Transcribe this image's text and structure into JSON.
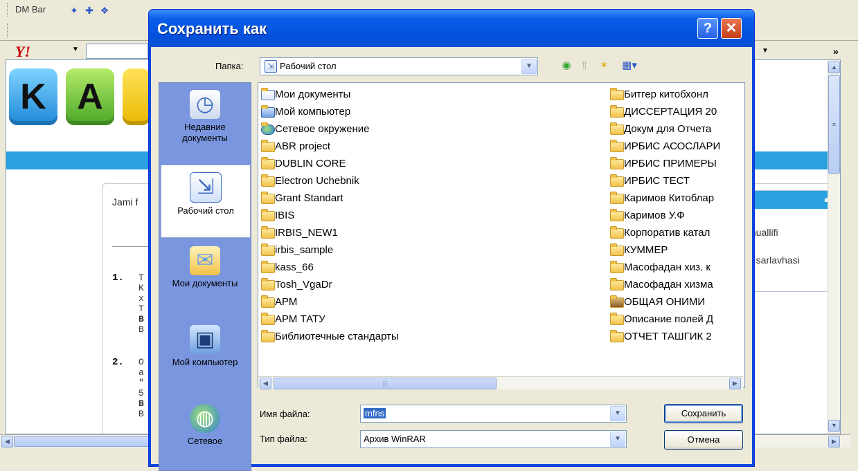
{
  "browser": {
    "toolbar_label": "DM Bar",
    "yahoo_logo": "Y!",
    "overflow": "»",
    "logo_letters": [
      "K",
      "A"
    ],
    "panel_text": "Jami f",
    "list_numbers": [
      "1.",
      "2."
    ],
    "col_fragment_1": [
      "T",
      "K",
      "x",
      "T",
      "B",
      "B"
    ],
    "col_fragment_2": [
      "O",
      "a",
      "\"",
      "5",
      "B",
      "B"
    ],
    "right_panel_lines": [
      "h",
      "muallifi",
      "b sarlavhasi"
    ]
  },
  "dialog": {
    "title": "Сохранить как",
    "help_label": "?",
    "close_label": "✕",
    "folder_label": "Папка:",
    "folder_value": "Рабочий стол",
    "places": [
      {
        "label": "Недавние документы",
        "icon": "recent-documents-icon"
      },
      {
        "label": "Рабочий стол",
        "icon": "desktop-icon"
      },
      {
        "label": "Мои документы",
        "icon": "my-documents-icon"
      },
      {
        "label": "Мой компьютер",
        "icon": "my-computer-icon"
      },
      {
        "label": "Сетевое",
        "icon": "network-icon"
      }
    ],
    "files_col1": [
      {
        "name": "Мои документы",
        "kind": "doc"
      },
      {
        "name": "Мой компьютер",
        "kind": "comp"
      },
      {
        "name": "Сетевое окружение",
        "kind": "net"
      },
      {
        "name": "ABR project",
        "kind": "folder"
      },
      {
        "name": "DUBLIN CORE",
        "kind": "folder"
      },
      {
        "name": "Electron Uchebnik",
        "kind": "folder"
      },
      {
        "name": "Grant Standart",
        "kind": "folder"
      },
      {
        "name": "IBIS",
        "kind": "folder"
      },
      {
        "name": "IRBIS_NEW1",
        "kind": "folder"
      },
      {
        "name": "irbis_sample",
        "kind": "folder"
      },
      {
        "name": "kass_66",
        "kind": "folder"
      },
      {
        "name": "Tosh_VgaDr",
        "kind": "folder"
      },
      {
        "name": "АРМ",
        "kind": "folder"
      },
      {
        "name": "АРМ ТАТУ",
        "kind": "folder"
      },
      {
        "name": "Библиотечные стандарты",
        "kind": "folder"
      }
    ],
    "files_col2": [
      {
        "name": "Битгер китобхонл",
        "kind": "folder"
      },
      {
        "name": "ДИССЕРТАЦИЯ 20",
        "kind": "folder"
      },
      {
        "name": "Докум для Отчета",
        "kind": "folder"
      },
      {
        "name": "ИРБИС АСОСЛАРИ",
        "kind": "folder"
      },
      {
        "name": "ИРБИС ПРИМЕРЫ",
        "kind": "folder"
      },
      {
        "name": "ИРБИС ТЕСТ",
        "kind": "folder"
      },
      {
        "name": "Каримов Китоблар",
        "kind": "folder"
      },
      {
        "name": "Каримов У.Ф",
        "kind": "folder"
      },
      {
        "name": "Корпоратив катал",
        "kind": "folder"
      },
      {
        "name": "КУММЕР",
        "kind": "folder"
      },
      {
        "name": "Масофадан хиз. к",
        "kind": "folder"
      },
      {
        "name": "Масофадан хизма",
        "kind": "folder"
      },
      {
        "name": "ОБЩАЯ ОНИМИ",
        "kind": "dark"
      },
      {
        "name": "Описание полей Д",
        "kind": "folder"
      },
      {
        "name": "ОТЧЕТ ТАШГИК 2",
        "kind": "folder"
      }
    ],
    "filename_label": "Имя файла:",
    "filename_value": "mfns",
    "filetype_label": "Тип файла:",
    "filetype_value": "Архив WinRAR",
    "save_button": "Сохранить",
    "cancel_button": "Отмена"
  }
}
